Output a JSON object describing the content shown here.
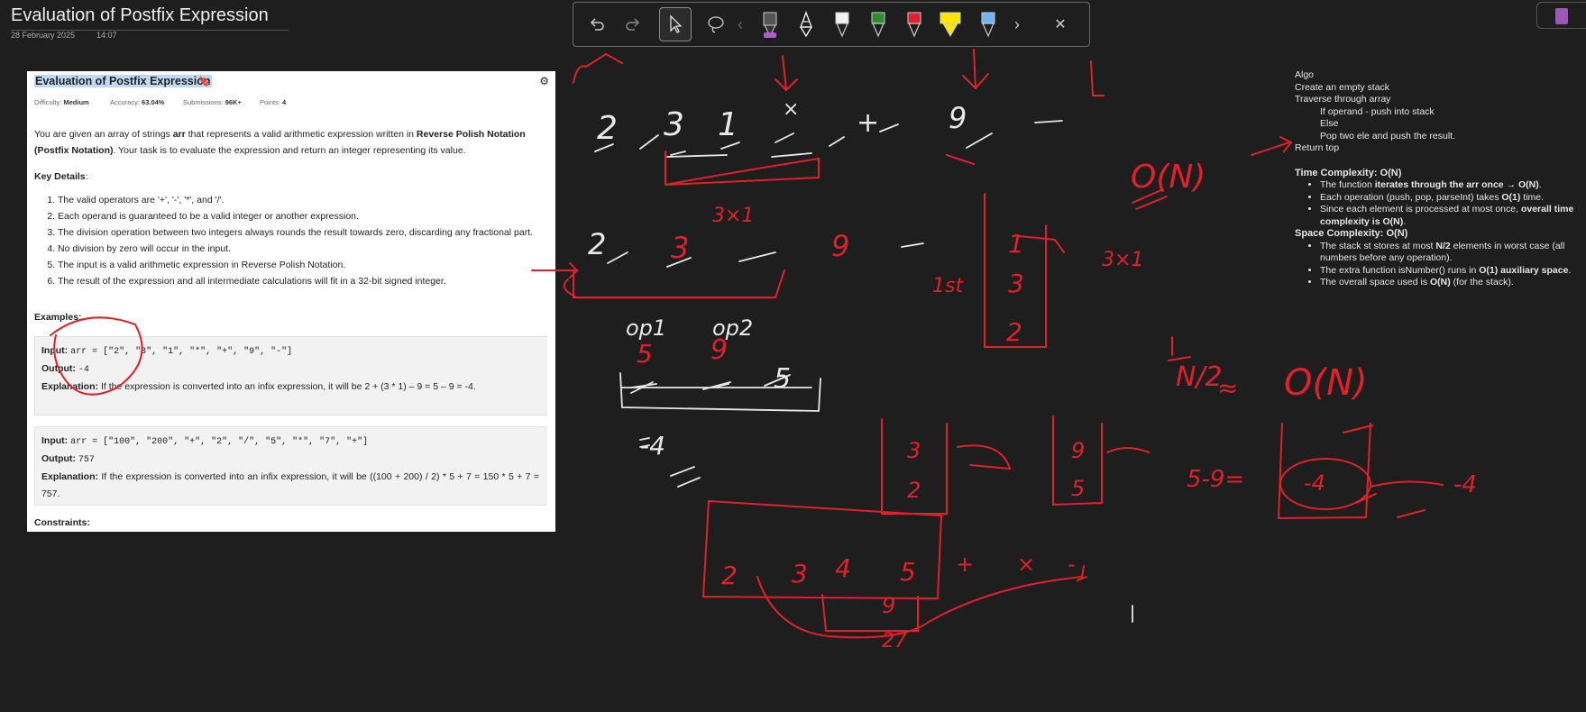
{
  "page": {
    "title": "Evaluation of Postfix Expression",
    "date": "28 February 2025",
    "time": "14:07"
  },
  "toolbar": {
    "tools": [
      "undo-icon",
      "redo-icon",
      "select-icon",
      "lasso-icon",
      "pen-black-icon",
      "pen-white-icon",
      "pen-green-icon",
      "pen-red-icon",
      "highlighter-yellow-icon",
      "pen-blue-icon"
    ],
    "prev": "‹",
    "next": "›",
    "close": "✕",
    "colors": {
      "pen_black": "#333333",
      "pen_white": "#f2f2f2",
      "pen_green": "#2e8b2e",
      "pen_red": "#e0202a",
      "highlighter": "#ffe600",
      "pen_blue": "#6cb4f0",
      "accent_purple": "#b05cd0"
    }
  },
  "problem": {
    "title": "Evaluation of Postfix Expression",
    "difficulty_label": "Difficulty:",
    "difficulty": "Medium",
    "accuracy_label": "Accuracy:",
    "accuracy": "63.04%",
    "submissions_label": "Submissions:",
    "submissions": "96K+",
    "points_label": "Points:",
    "points": "4",
    "intro_1": "You are given an array of strings ",
    "intro_arr": "arr",
    "intro_2": " that represents a valid arithmetic expression written in ",
    "intro_rpn": "Reverse Polish Notation (Postfix Notation)",
    "intro_3": ". Your task is to evaluate the expression and return an integer representing its value.",
    "key_details_label": "Key Details",
    "key_details": [
      "The valid operators are '+', '-', '*', and '/'.",
      "Each operand is guaranteed to be a valid integer or another expression.",
      "The division operation between two integers always rounds the result towards zero, discarding any fractional part.",
      "No division by zero will occur in the input.",
      "The input is a valid arithmetic expression in Reverse Polish Notation.",
      "The result of the expression and all intermediate calculations will fit in a 32-bit signed integer."
    ],
    "examples_label": "Examples:",
    "examples": [
      {
        "input_label": "Input:",
        "input": "arr = [\"2\", \"3\", \"1\", \"*\", \"+\", \"9\", \"-\"]",
        "output_label": "Output:",
        "output": "-4",
        "explanation_label": "Explanation:",
        "explanation": "If the expression is converted into an infix expression, it will be 2 + (3 * 1) – 9 = 5 – 9 = -4."
      },
      {
        "input_label": "Input:",
        "input": "arr = [\"100\", \"200\", \"+\", \"2\", \"/\", \"5\", \"*\", \"7\", \"+\"]",
        "output_label": "Output:",
        "output": "757",
        "explanation_label": "Explanation:",
        "explanation": "If the expression is converted into an infix expression, it will be ((100 + 200) / 2) * 5 + 7 = 150 * 5 + 7 = 757."
      }
    ],
    "constraints_label": "Constraints:"
  },
  "notes": {
    "algo": [
      {
        "text": "Algo",
        "indent": false
      },
      {
        "text": "Create an empty stack",
        "indent": false
      },
      {
        "text": "Traverse through array",
        "indent": false
      },
      {
        "text": "If operand - push into stack",
        "indent": true
      },
      {
        "text": "Else",
        "indent": true
      },
      {
        "text": "Pop two ele and push the result.",
        "indent": true
      },
      {
        "text": "Return top",
        "indent": false
      }
    ],
    "time_heading": "Time Complexity: O(N)",
    "time_items": [
      {
        "pre": "The function ",
        "bold": "iterates through the arr once → O(N)",
        "post": "."
      },
      {
        "pre": "Each operation (push, pop, parseInt) takes ",
        "bold": "O(1)",
        "post": " time."
      },
      {
        "pre": "Since each element is processed at most once, ",
        "bold": "overall time complexity is O(N)",
        "post": "."
      }
    ],
    "space_heading": "Space Complexity: O(N)",
    "space_items": [
      {
        "pre": "The stack st stores at most ",
        "bold": "N/2",
        "post": " elements in worst case (all numbers before any operation)."
      },
      {
        "pre": "The extra function isNumber() runs in ",
        "bold": "O(1) auxiliary space",
        "post": "."
      },
      {
        "pre": "The overall space used is ",
        "bold": "O(N)",
        "post": " (for the stack)."
      }
    ]
  },
  "handwriting": {
    "white_tokens": [
      "2",
      "3",
      "1",
      "×",
      "+",
      "9",
      "3×1",
      "2",
      "3",
      "9",
      "op1",
      "op2",
      "5",
      "9",
      "5",
      "-4"
    ],
    "red_tokens": [
      "arr",
      "O(N)",
      "1st",
      "1",
      "3",
      "2",
      "3×1",
      "3",
      "2",
      "9",
      "5",
      "5-9=",
      "-4",
      "-4",
      "N/2",
      "≈",
      "O(N)",
      "2",
      "3",
      "4",
      "5",
      "+",
      "×",
      "-",
      "9",
      "27"
    ]
  }
}
